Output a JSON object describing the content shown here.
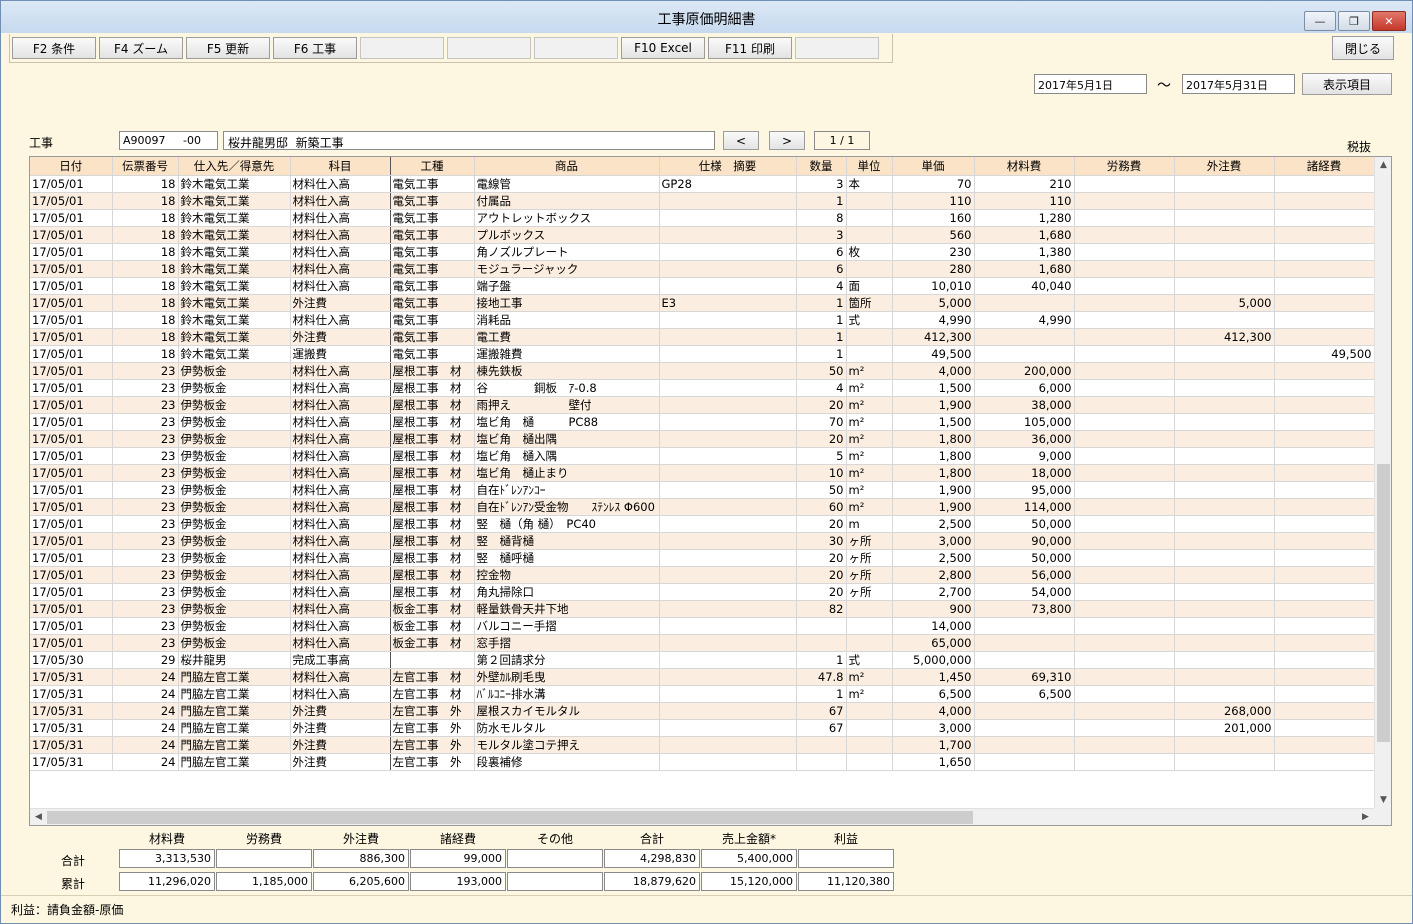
{
  "window": {
    "title": "工事原価明細書",
    "min_label": "—",
    "max_label": "❐",
    "close_label": "✕"
  },
  "fkeys": [
    "F2 条件",
    "F4 ズーム",
    "F5 更新",
    "F6 工事",
    "",
    "",
    "",
    "F10 Excel",
    "F11 印刷",
    ""
  ],
  "close_button": "閉じる",
  "date_from": "2017年5月1日",
  "date_tilde": "～",
  "date_to": "2017年5月31日",
  "display_items_button": "表示項目",
  "project": {
    "label": "工事",
    "code": "A90097     -00",
    "name": "桜井龍男邸  新築工事",
    "prev": "<",
    "next": ">",
    "page": "1 / 1"
  },
  "tax_label": "税抜",
  "columns": [
    "日付",
    "伝票番号",
    "仕入先／得意先",
    "科目",
    "工種",
    "商品",
    "仕様　摘要",
    "数量",
    "単位",
    "単価",
    "材料費",
    "労務費",
    "外注費",
    "諸経費"
  ],
  "rows": [
    [
      "17/05/01",
      "18",
      "鈴木電気工業",
      "材料仕入高",
      "電気工事",
      "電線管",
      "GP28",
      "3",
      "本",
      "70",
      "210",
      "",
      "",
      ""
    ],
    [
      "17/05/01",
      "18",
      "鈴木電気工業",
      "材料仕入高",
      "電気工事",
      "付属品",
      "",
      "1",
      "",
      "110",
      "110",
      "",
      "",
      ""
    ],
    [
      "17/05/01",
      "18",
      "鈴木電気工業",
      "材料仕入高",
      "電気工事",
      "アウトレットボックス",
      "",
      "8",
      "",
      "160",
      "1,280",
      "",
      "",
      ""
    ],
    [
      "17/05/01",
      "18",
      "鈴木電気工業",
      "材料仕入高",
      "電気工事",
      "プルボックス",
      "",
      "3",
      "",
      "560",
      "1,680",
      "",
      "",
      ""
    ],
    [
      "17/05/01",
      "18",
      "鈴木電気工業",
      "材料仕入高",
      "電気工事",
      "角ノズルプレート",
      "",
      "6",
      "枚",
      "230",
      "1,380",
      "",
      "",
      ""
    ],
    [
      "17/05/01",
      "18",
      "鈴木電気工業",
      "材料仕入高",
      "電気工事",
      "モジュラージャック",
      "",
      "6",
      "",
      "280",
      "1,680",
      "",
      "",
      ""
    ],
    [
      "17/05/01",
      "18",
      "鈴木電気工業",
      "材料仕入高",
      "電気工事",
      "端子盤",
      "",
      "4",
      "面",
      "10,010",
      "40,040",
      "",
      "",
      ""
    ],
    [
      "17/05/01",
      "18",
      "鈴木電気工業",
      "外注費",
      "電気工事",
      "接地工事",
      "E3",
      "1",
      "箇所",
      "5,000",
      "",
      "",
      "5,000",
      ""
    ],
    [
      "17/05/01",
      "18",
      "鈴木電気工業",
      "材料仕入高",
      "電気工事",
      "消耗品",
      "",
      "1",
      "式",
      "4,990",
      "4,990",
      "",
      "",
      ""
    ],
    [
      "17/05/01",
      "18",
      "鈴木電気工業",
      "外注費",
      "電気工事",
      "電工費",
      "",
      "1",
      "",
      "412,300",
      "",
      "",
      "412,300",
      ""
    ],
    [
      "17/05/01",
      "18",
      "鈴木電気工業",
      "運搬費",
      "電気工事",
      "運搬雑費",
      "",
      "1",
      "",
      "49,500",
      "",
      "",
      "",
      "49,500"
    ],
    [
      "17/05/01",
      "23",
      "伊勢板金",
      "材料仕入高",
      "屋根工事　材",
      "棟先鉄板",
      "",
      "50",
      "m²",
      "4,000",
      "200,000",
      "",
      "",
      ""
    ],
    [
      "17/05/01",
      "23",
      "伊勢板金",
      "材料仕入高",
      "屋根工事　材",
      "谷　　　　銅板　ｱ-0.8",
      "",
      "4",
      "m²",
      "1,500",
      "6,000",
      "",
      "",
      ""
    ],
    [
      "17/05/01",
      "23",
      "伊勢板金",
      "材料仕入高",
      "屋根工事　材",
      "雨押え　　　　　壁付",
      "",
      "20",
      "m²",
      "1,900",
      "38,000",
      "",
      "",
      ""
    ],
    [
      "17/05/01",
      "23",
      "伊勢板金",
      "材料仕入高",
      "屋根工事　材",
      "塩ビ角　樋　　　PC88",
      "",
      "70",
      "m²",
      "1,500",
      "105,000",
      "",
      "",
      ""
    ],
    [
      "17/05/01",
      "23",
      "伊勢板金",
      "材料仕入高",
      "屋根工事　材",
      "塩ビ角　樋出隅",
      "",
      "20",
      "m²",
      "1,800",
      "36,000",
      "",
      "",
      ""
    ],
    [
      "17/05/01",
      "23",
      "伊勢板金",
      "材料仕入高",
      "屋根工事　材",
      "塩ビ角　樋入隅",
      "",
      "5",
      "m²",
      "1,800",
      "9,000",
      "",
      "",
      ""
    ],
    [
      "17/05/01",
      "23",
      "伊勢板金",
      "材料仕入高",
      "屋根工事　材",
      "塩ビ角　樋止まり",
      "",
      "10",
      "m²",
      "1,800",
      "18,000",
      "",
      "",
      ""
    ],
    [
      "17/05/01",
      "23",
      "伊勢板金",
      "材料仕入高",
      "屋根工事　材",
      "自在ﾄﾞﾚﾝｱﾝｺｰ",
      "",
      "50",
      "m²",
      "1,900",
      "95,000",
      "",
      "",
      ""
    ],
    [
      "17/05/01",
      "23",
      "伊勢板金",
      "材料仕入高",
      "屋根工事　材",
      "自在ﾄﾞﾚﾝｱﾝ受金物　　ｽﾃﾝﾚｽ Φ600",
      "",
      "60",
      "m²",
      "1,900",
      "114,000",
      "",
      "",
      ""
    ],
    [
      "17/05/01",
      "23",
      "伊勢板金",
      "材料仕入高",
      "屋根工事　材",
      "竪　樋（角 樋）　PC40",
      "",
      "20",
      "m",
      "2,500",
      "50,000",
      "",
      "",
      ""
    ],
    [
      "17/05/01",
      "23",
      "伊勢板金",
      "材料仕入高",
      "屋根工事　材",
      "竪　樋背樋",
      "",
      "30",
      "ヶ所",
      "3,000",
      "90,000",
      "",
      "",
      ""
    ],
    [
      "17/05/01",
      "23",
      "伊勢板金",
      "材料仕入高",
      "屋根工事　材",
      "竪　樋呼樋",
      "",
      "20",
      "ヶ所",
      "2,500",
      "50,000",
      "",
      "",
      ""
    ],
    [
      "17/05/01",
      "23",
      "伊勢板金",
      "材料仕入高",
      "屋根工事　材",
      "控金物",
      "",
      "20",
      "ヶ所",
      "2,800",
      "56,000",
      "",
      "",
      ""
    ],
    [
      "17/05/01",
      "23",
      "伊勢板金",
      "材料仕入高",
      "屋根工事　材",
      "角丸掃除口",
      "",
      "20",
      "ヶ所",
      "2,700",
      "54,000",
      "",
      "",
      ""
    ],
    [
      "17/05/01",
      "23",
      "伊勢板金",
      "材料仕入高",
      "板金工事　材",
      "軽量鉄骨天井下地",
      "",
      "82",
      "",
      "900",
      "73,800",
      "",
      "",
      ""
    ],
    [
      "17/05/01",
      "23",
      "伊勢板金",
      "材料仕入高",
      "板金工事　材",
      "バルコニー手摺",
      "",
      "",
      "",
      "14,000",
      "",
      "",
      "",
      ""
    ],
    [
      "17/05/01",
      "23",
      "伊勢板金",
      "材料仕入高",
      "板金工事　材",
      "窓手摺",
      "",
      "",
      "",
      "65,000",
      "",
      "",
      "",
      ""
    ],
    [
      "17/05/30",
      "29",
      "桜井龍男",
      "完成工事高",
      "",
      "第２回請求分",
      "",
      "1",
      "式",
      "5,000,000",
      "",
      "",
      "",
      ""
    ],
    [
      "17/05/31",
      "24",
      "門脇左官工業",
      "材料仕入高",
      "左官工事　材",
      "外壁ｶﾙ刷毛曳",
      "",
      "47.8",
      "m²",
      "1,450",
      "69,310",
      "",
      "",
      ""
    ],
    [
      "17/05/31",
      "24",
      "門脇左官工業",
      "材料仕入高",
      "左官工事　材",
      "ﾊﾞﾙｺﾆｰ排水溝",
      "",
      "1",
      "m²",
      "6,500",
      "6,500",
      "",
      "",
      ""
    ],
    [
      "17/05/31",
      "24",
      "門脇左官工業",
      "外注費",
      "左官工事　外",
      "屋根スカイモルタル",
      "",
      "67",
      "",
      "4,000",
      "",
      "",
      "268,000",
      ""
    ],
    [
      "17/05/31",
      "24",
      "門脇左官工業",
      "外注費",
      "左官工事　外",
      "防水モルタル",
      "",
      "67",
      "",
      "3,000",
      "",
      "",
      "201,000",
      ""
    ],
    [
      "17/05/31",
      "24",
      "門脇左官工業",
      "外注費",
      "左官工事　外",
      "モルタル塗コテ押え",
      "",
      "",
      "",
      "1,700",
      "",
      "",
      "",
      ""
    ],
    [
      "17/05/31",
      "24",
      "門脇左官工業",
      "外注費",
      "左官工事　外",
      "段裏補修",
      "",
      "",
      "",
      "1,650",
      "",
      "",
      "",
      ""
    ]
  ],
  "scroll": {
    "up": "▲",
    "down": "▼",
    "left": "◀",
    "right": "▶"
  },
  "summary": {
    "headers": [
      "材料費",
      "労務費",
      "外注費",
      "諸経費",
      "その他",
      "合計",
      "売上金額*",
      "利益"
    ],
    "total_label": "合計",
    "total": [
      "3,313,530",
      "",
      "886,300",
      "99,000",
      "",
      "4,298,830",
      "5,400,000",
      ""
    ],
    "cumulative_label": "累計",
    "cumulative": [
      "11,296,020",
      "1,185,000",
      "6,205,600",
      "193,000",
      "",
      "18,879,620",
      "15,120,000",
      "11,120,380"
    ]
  },
  "status": "利益：請負金額-原価"
}
